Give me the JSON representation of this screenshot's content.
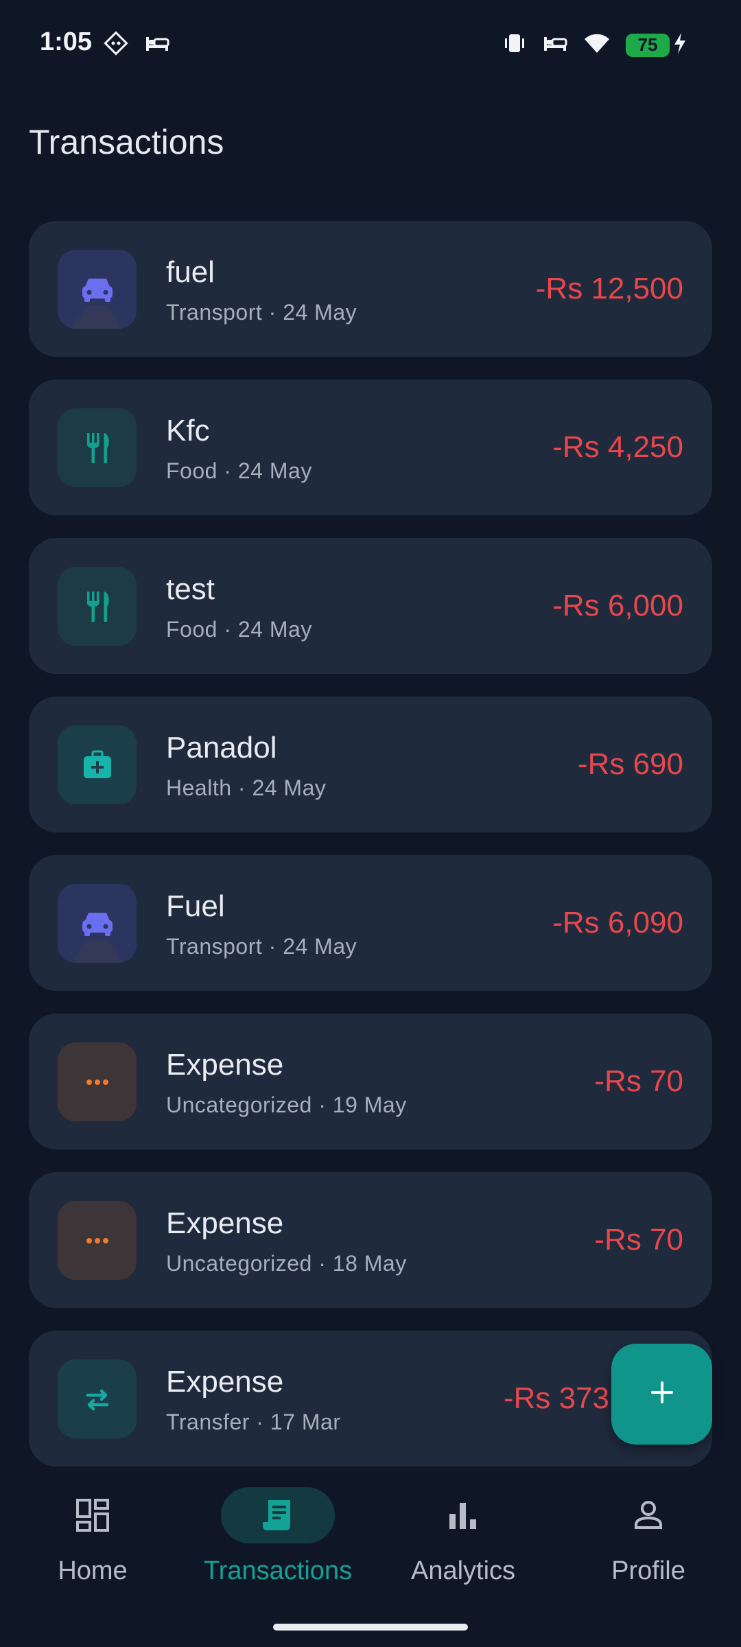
{
  "status": {
    "time": "1:05",
    "battery": "75",
    "icons_left": [
      "game-icon",
      "bed-icon"
    ],
    "icons_right": [
      "vibrate-icon",
      "bed-icon",
      "wifi-icon",
      "battery-icon",
      "charging-icon"
    ]
  },
  "page": {
    "title": "Transactions"
  },
  "transactions": [
    {
      "title": "fuel",
      "subtitle": "Transport · 24 May",
      "amount": "-Rs 12,500",
      "icon": "car-icon",
      "icon_color": "#6c6ef0",
      "icon_bg": "#2c3560"
    },
    {
      "title": "Kfc",
      "subtitle": "Food · 24 May",
      "amount": "-Rs 4,250",
      "icon": "utensils-icon",
      "icon_color": "#13a08f",
      "icon_bg": "#1c3b45"
    },
    {
      "title": "test",
      "subtitle": "Food · 24 May",
      "amount": "-Rs 6,000",
      "icon": "utensils-icon",
      "icon_color": "#13a08f",
      "icon_bg": "#1c3b45"
    },
    {
      "title": "Panadol",
      "subtitle": "Health · 24 May",
      "amount": "-Rs 690",
      "icon": "medical-kit-icon",
      "icon_color": "#18b4aa",
      "icon_bg": "#1b3e4b"
    },
    {
      "title": "Fuel",
      "subtitle": "Transport · 24 May",
      "amount": "-Rs 6,090",
      "icon": "car-icon",
      "icon_color": "#6c6ef0",
      "icon_bg": "#2c3560"
    },
    {
      "title": "Expense",
      "subtitle": "Uncategorized · 19 May",
      "amount": "-Rs 70",
      "icon": "more-dots-icon",
      "icon_color": "#f07a2e",
      "icon_bg": "#3d3537"
    },
    {
      "title": "Expense",
      "subtitle": "Uncategorized · 18 May",
      "amount": "-Rs 70",
      "icon": "more-dots-icon",
      "icon_color": "#f07a2e",
      "icon_bg": "#3d3537"
    },
    {
      "title": "Expense",
      "subtitle": "Transfer · 17 Mar",
      "amount": "-Rs 373",
      "icon": "transfer-arrows-icon",
      "icon_color": "#19a9a2",
      "icon_bg": "#1b3e4b"
    }
  ],
  "fab": {
    "icon": "plus-icon",
    "color": "#0f958a"
  },
  "nav": {
    "items": [
      {
        "label": "Home",
        "icon": "dashboard-icon"
      },
      {
        "label": "Transactions",
        "icon": "receipt-icon"
      },
      {
        "label": "Analytics",
        "icon": "bar-chart-icon"
      },
      {
        "label": "Profile",
        "icon": "person-icon"
      }
    ],
    "active_color": "#14a294",
    "inactive_color": "#b7bdc8",
    "active_pill": "#123a40"
  },
  "colors": {
    "background": "#0f1727",
    "card": "#1f2a3c",
    "amount_negative": "#e8474b"
  }
}
